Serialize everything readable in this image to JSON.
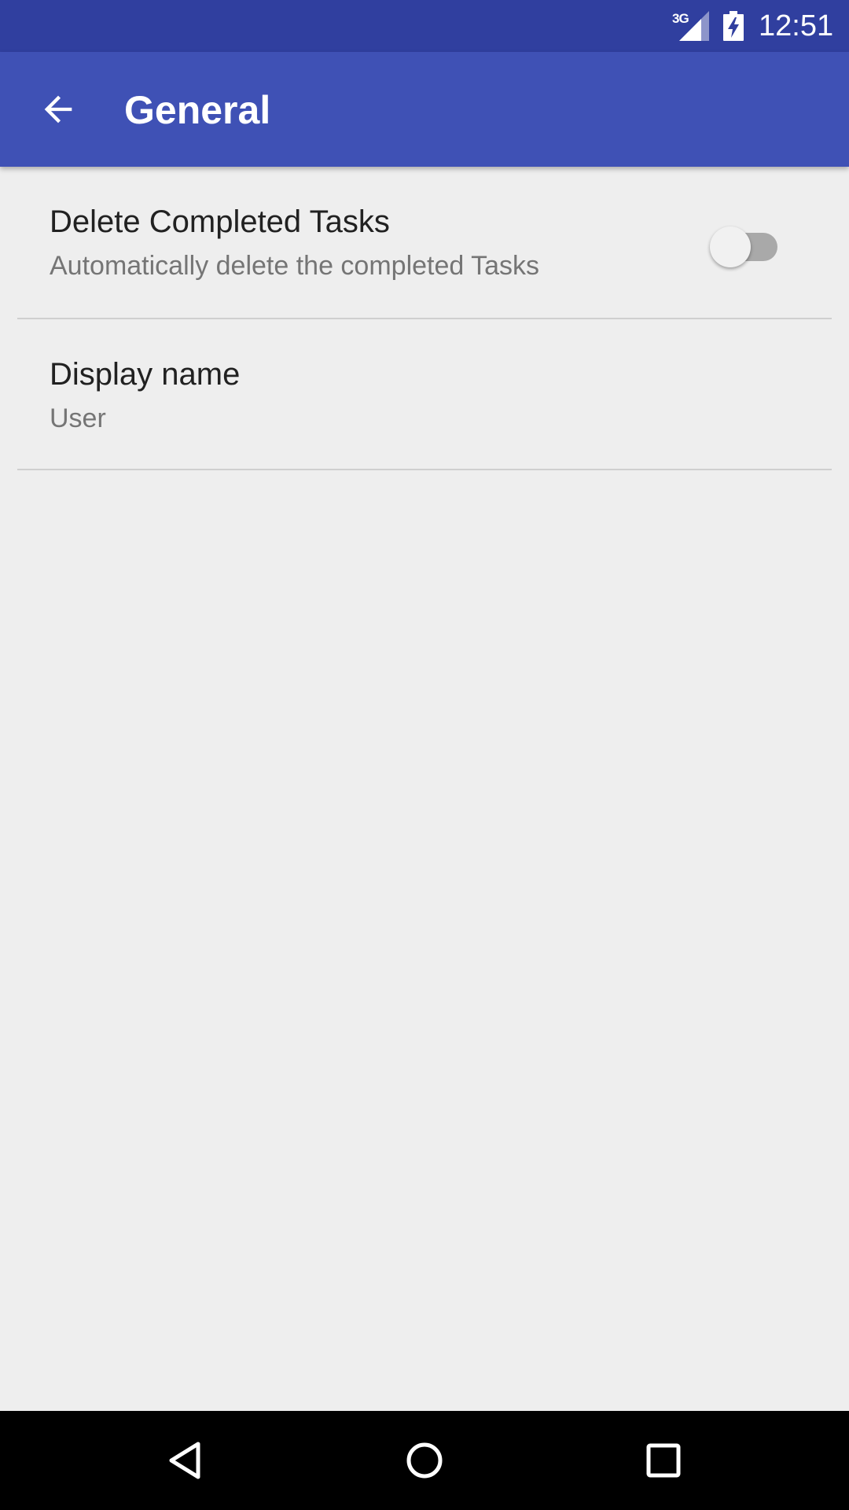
{
  "status_bar": {
    "network": "3G",
    "time": "12:51"
  },
  "app_bar": {
    "title": "General",
    "back_icon": "arrow-back-icon"
  },
  "preferences": [
    {
      "title": "Delete Completed Tasks",
      "summary": "Automatically delete the completed Tasks",
      "switch_on": false
    },
    {
      "title": "Display name",
      "summary": "User"
    }
  ],
  "nav_bar": {
    "icons": [
      "back-triangle-icon",
      "home-circle-icon",
      "recents-square-icon"
    ]
  },
  "colors": {
    "status_bar": "#303f9f",
    "app_bar": "#3f51b5",
    "background": "#eeeeee",
    "title_text": "#212121",
    "summary_text": "#757575",
    "switch_track_off": "#a9a9a9",
    "switch_thumb_off": "#f1f1f1"
  }
}
